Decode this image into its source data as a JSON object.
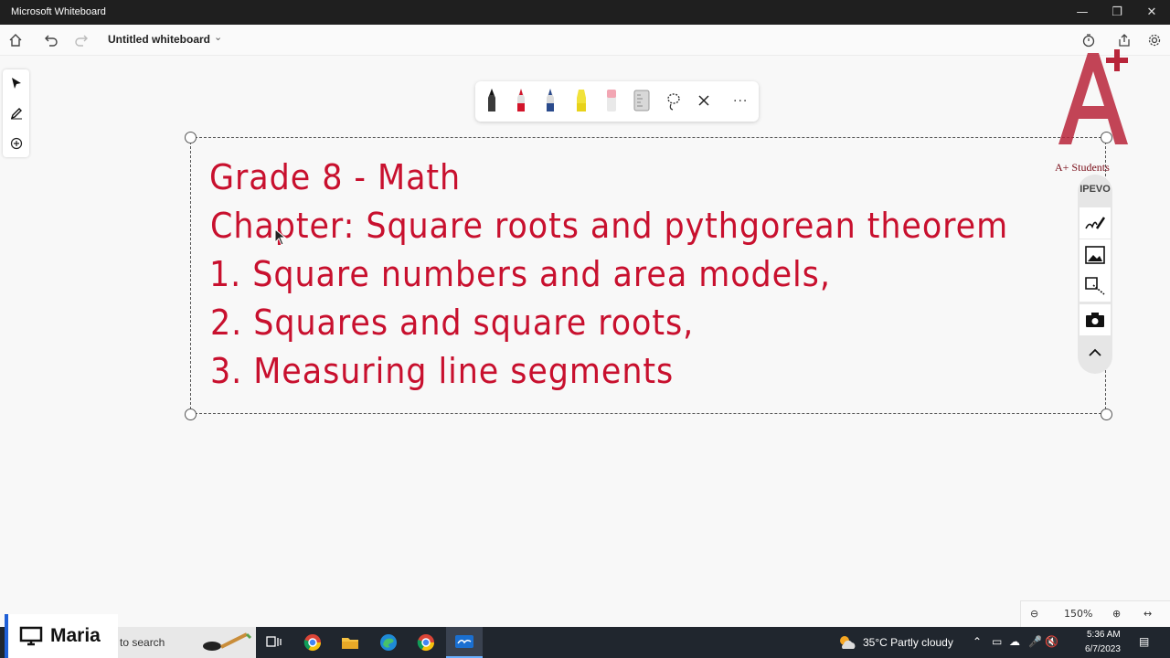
{
  "window": {
    "title": "Microsoft Whiteboard"
  },
  "toolbar": {
    "board_title": "Untitled whiteboard"
  },
  "board": {
    "lines": [
      "Grade 8 - Math",
      "Chapter: Square roots and pythgorean theorem",
      "1. Square numbers and area models,",
      "2. Squares and square roots,",
      "3. Measuring line segments"
    ],
    "ink_color": "#c8102e"
  },
  "logo": {
    "caption": "A+ Students"
  },
  "ipevo": {
    "label": "IPEVO"
  },
  "zoom": {
    "level": "150%"
  },
  "taskbar": {
    "search_placeholder": "to search",
    "presenter_name": "Maria",
    "weather": "35°C  Partly cloudy",
    "time": "5:36 AM",
    "date": "6/7/2023"
  },
  "colors": {
    "accent": "#1e5fd6",
    "taskbar": "#20262e",
    "ink": "#c8102e"
  }
}
